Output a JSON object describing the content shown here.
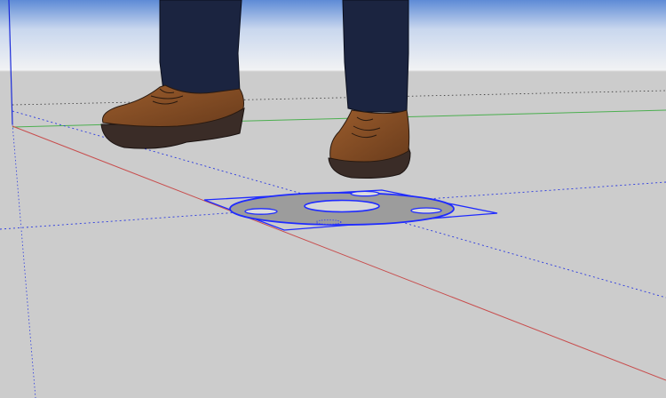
{
  "scene": {
    "sky_top_color": "#5e8bd6",
    "sky_bottom_color": "#f4f4f4",
    "ground_color": "#cccccc",
    "axis_red_color": "#c84d4d",
    "axis_green_color": "#4caf50",
    "axis_blue_color": "#1b2bd9",
    "axis_inference_color": "#2a39e0",
    "shoe_color": "#7b4a24",
    "sole_color": "#3a2c27",
    "pants_color": "#1b2440",
    "washer_fill_color": "#9c9c9c",
    "selection_color": "#1f2bff"
  }
}
